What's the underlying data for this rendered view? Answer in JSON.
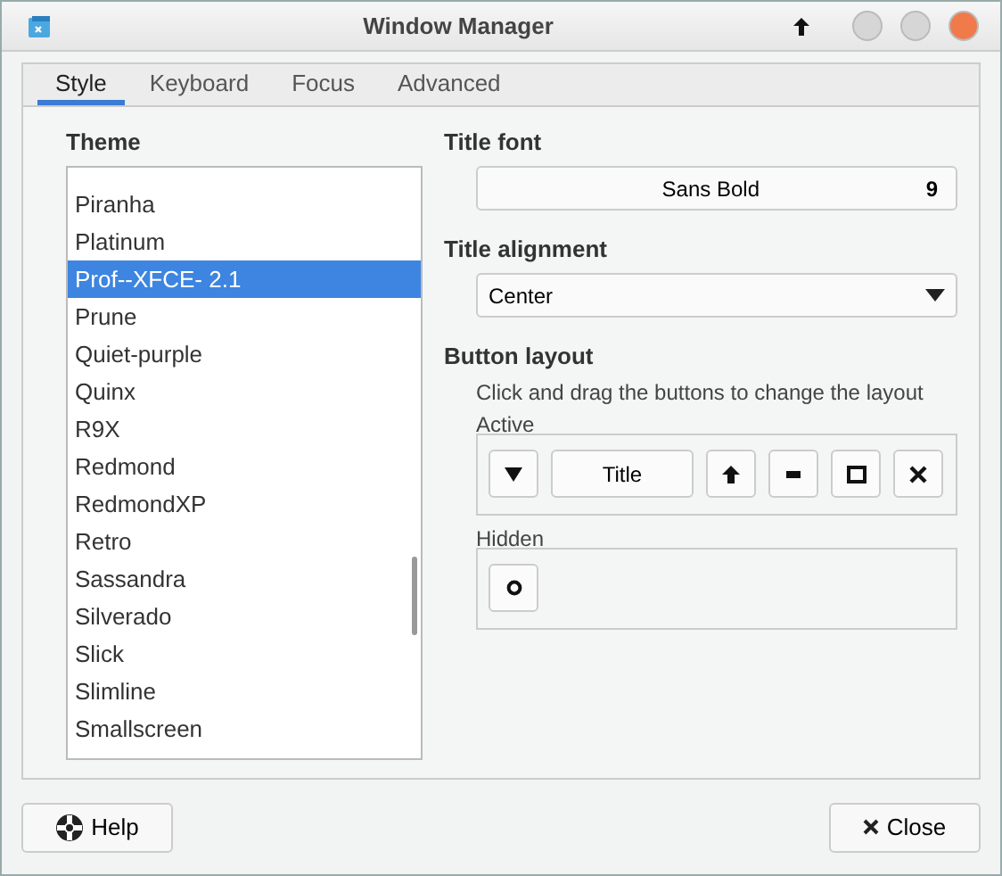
{
  "window": {
    "title": "Window Manager"
  },
  "tabs": [
    {
      "label": "Style",
      "selected": true
    },
    {
      "label": "Keyboard",
      "selected": false
    },
    {
      "label": "Focus",
      "selected": false
    },
    {
      "label": "Advanced",
      "selected": false
    }
  ],
  "theme": {
    "heading": "Theme",
    "items": [
      {
        "label": "Piranha",
        "selected": false
      },
      {
        "label": "Platinum",
        "selected": false
      },
      {
        "label": "Prof--XFCE- 2.1",
        "selected": true
      },
      {
        "label": "Prune",
        "selected": false
      },
      {
        "label": "Quiet-purple",
        "selected": false
      },
      {
        "label": "Quinx",
        "selected": false
      },
      {
        "label": "R9X",
        "selected": false
      },
      {
        "label": "Redmond",
        "selected": false
      },
      {
        "label": "RedmondXP",
        "selected": false
      },
      {
        "label": "Retro",
        "selected": false
      },
      {
        "label": "Sassandra",
        "selected": false
      },
      {
        "label": "Silverado",
        "selected": false
      },
      {
        "label": "Slick",
        "selected": false
      },
      {
        "label": "Slimline",
        "selected": false
      },
      {
        "label": "Smallscreen",
        "selected": false
      }
    ]
  },
  "title_font": {
    "heading": "Title font",
    "font": "Sans Bold",
    "size": "9"
  },
  "title_alignment": {
    "heading": "Title alignment",
    "value": "Center"
  },
  "button_layout": {
    "heading": "Button layout",
    "hint": "Click and drag the buttons to change the layout",
    "active": {
      "label": "Active",
      "buttons": [
        {
          "kind": "menu"
        },
        {
          "kind": "title",
          "label": "Title"
        },
        {
          "kind": "shade"
        },
        {
          "kind": "minimize"
        },
        {
          "kind": "maximize"
        },
        {
          "kind": "close"
        }
      ]
    },
    "hidden": {
      "label": "Hidden",
      "buttons": [
        {
          "kind": "stick"
        }
      ]
    }
  },
  "footer": {
    "help": "Help",
    "close": "Close"
  }
}
